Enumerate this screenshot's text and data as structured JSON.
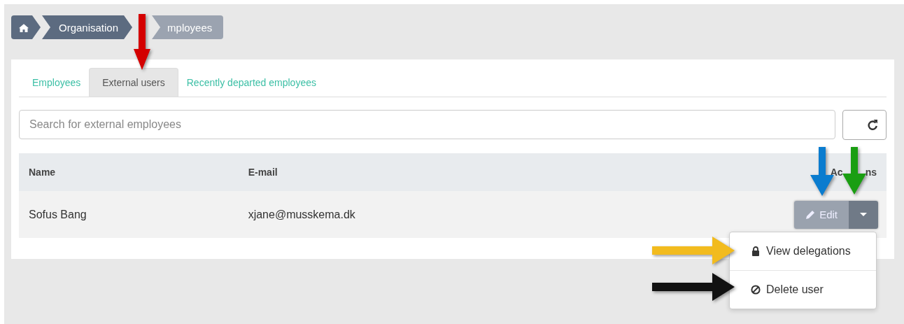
{
  "breadcrumb": [
    {
      "kind": "home"
    },
    {
      "kind": "link",
      "label": "Organisation"
    },
    {
      "kind": "current",
      "label": "mployees"
    }
  ],
  "tabs": [
    {
      "label": "Employees",
      "selected": false
    },
    {
      "label": "External users",
      "selected": true
    },
    {
      "label": "Recently departed employees",
      "selected": false
    }
  ],
  "search": {
    "placeholder": "Search for external employees"
  },
  "table": {
    "columns": [
      {
        "parts": [
          "Name"
        ]
      },
      {
        "parts": [
          "E-mail"
        ]
      },
      {
        "parts": [
          "Ac",
          "ns"
        ]
      }
    ],
    "rows": [
      {
        "cells": [
          "Sofus Bang",
          "xjane@musskema.dk"
        ],
        "edit_label": "Edit"
      }
    ]
  },
  "dropdown": {
    "expanded": true,
    "items": [
      {
        "kind": "lock",
        "label": "View delegations"
      },
      {
        "kind": "ban",
        "label": "Delete user"
      }
    ]
  },
  "annotations": [
    {
      "kind": "down-arrow",
      "color": "#d40000"
    },
    {
      "kind": "down-arrow",
      "color": "#0a7ccf"
    },
    {
      "kind": "down-arrow",
      "color": "#1a9e12"
    },
    {
      "kind": "right-arrow",
      "color": "#f2bb1e"
    },
    {
      "kind": "right-arrow",
      "color": "#111111"
    }
  ]
}
